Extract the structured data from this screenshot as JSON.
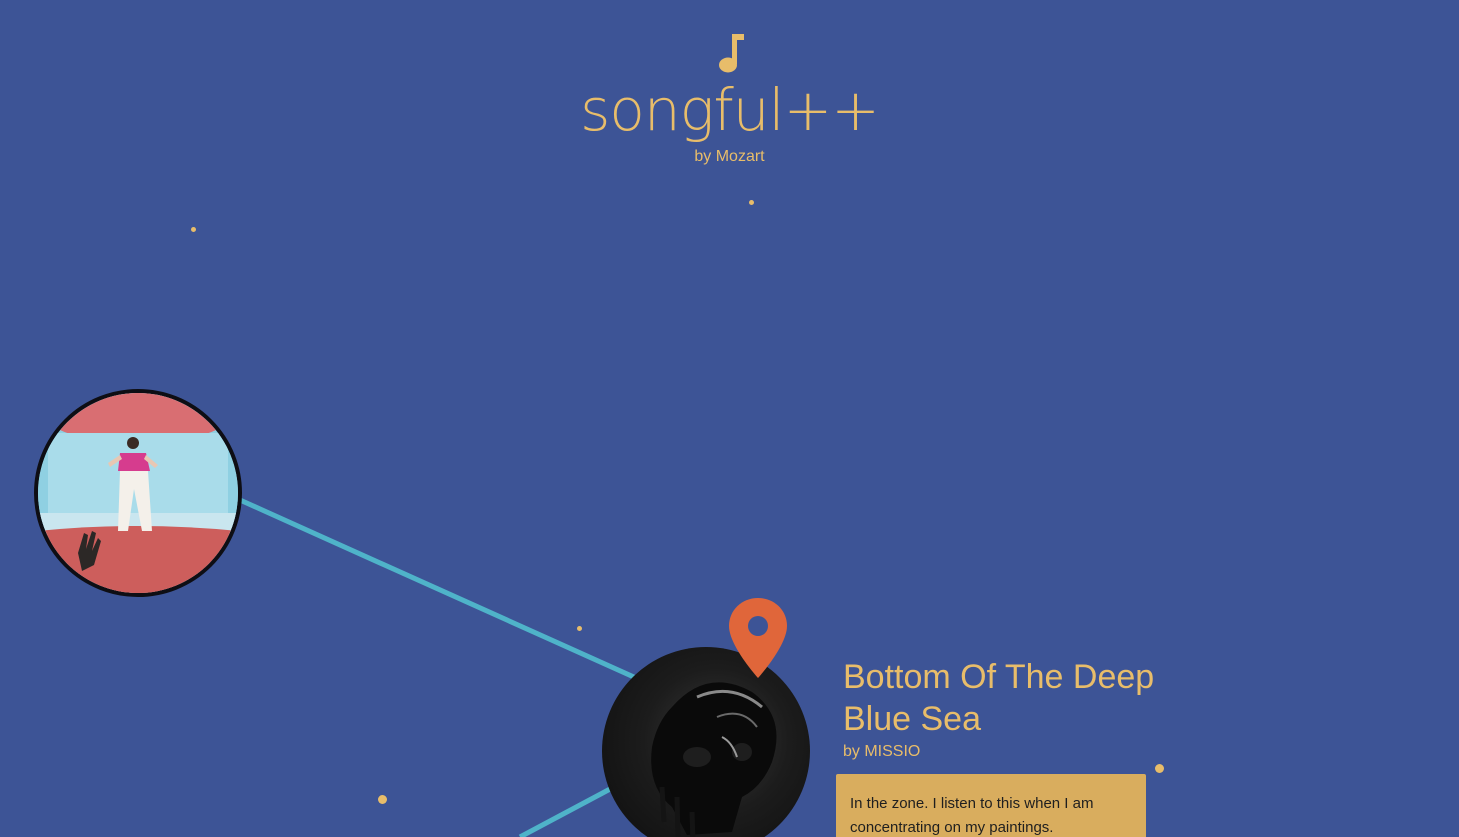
{
  "header": {
    "logo_icon": "music-note-icon",
    "title": "songful++",
    "subtitle": "by Mozart"
  },
  "graph": {
    "nodes": [
      {
        "name": "album-art-harrys-house",
        "icon": "album-cover"
      },
      {
        "name": "album-art-bottom-of-the-deep-blue-sea",
        "icon": "album-cover"
      }
    ],
    "selected": {
      "marker_icon": "location-pin-icon",
      "song_title": "Bottom Of The Deep Blue Sea",
      "artist": "by MISSIO",
      "comment": "In the zone. I listen to this when I am concentrating on my paintings."
    }
  },
  "colors": {
    "background": "#3d5496",
    "accent": "#e8bd6a",
    "edge": "#4fb3c9",
    "pin": "#e0663a",
    "card": "#d9ad5e"
  }
}
